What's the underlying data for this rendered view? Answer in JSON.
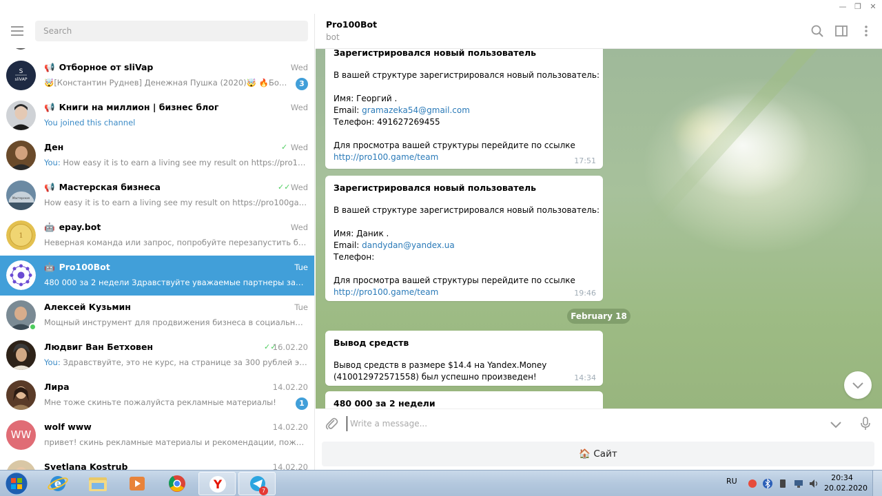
{
  "window": {
    "min_glyph": "—",
    "max_glyph": "❐",
    "close_glyph": "✕"
  },
  "sidebar": {
    "search_placeholder": "Search",
    "chats": [
      {
        "name": "Отборное от sliVap",
        "prefix": "📢",
        "time": "Wed",
        "preview": "🤯[Константин Руднев] Денежная Пушка (2020)🤯  🔥Бом...",
        "unread": "3",
        "avatar": "slivap"
      },
      {
        "name": "Книги на миллион | бизнес блог",
        "prefix": "📢",
        "time": "Wed",
        "preview": "You joined this channel",
        "avatar": "face-dark"
      },
      {
        "name": "Ден",
        "time": "Wed",
        "you": "You:",
        "preview": "How easy it is to earn a living see my result on https://pro100g...",
        "ticks": "✓",
        "avatar": "face-den"
      },
      {
        "name": "Мастерская бизнеса",
        "prefix": "📢",
        "time": "Wed",
        "preview": "How easy it is to earn a living see my result on https://pro100game...",
        "ticks": "✓✓",
        "avatar": "car"
      },
      {
        "name": "epay.bot",
        "prefix": "🤖",
        "time": "Wed",
        "preview": "Неверная команда или запрос, попробуйте перезапустить бота...",
        "avatar": "coin"
      },
      {
        "name": "Pro100Bot",
        "prefix": "🤖",
        "time": "Tue",
        "preview": "480 000 за 2 недели  Здравствуйте уважаемые партнеры записал...",
        "active": true,
        "avatar": "pro100"
      },
      {
        "name": "Алексей Кузьмин",
        "time": "Tue",
        "preview": "Мощный инструмент для продвижения бизнеса в социальных ...",
        "online": true,
        "avatar": "face-alexey"
      },
      {
        "name": "Людвиг Ван Бетховен",
        "time": "16.02.20",
        "you": "You:",
        "preview": "Здравствуйте, это не курс, на странице за 300 рублей это ре...",
        "ticks": "✓✓",
        "avatar": "beethoven"
      },
      {
        "name": "Лира",
        "time": "14.02.20",
        "preview": "Мне тоже скиньте пожалуйста рекламные материалы!",
        "unread": "1",
        "avatar": "lira"
      },
      {
        "name": "wolf www",
        "time": "14.02.20",
        "preview": "привет! скинь рекламные материалы и рекомендации, пожалу...",
        "avatar": "initials",
        "initials": "WW"
      },
      {
        "name": "Svetlana Kostrub",
        "time": "14.02.20",
        "preview": "",
        "avatar": "face-svetlana"
      }
    ]
  },
  "header": {
    "title": "Pro100Bot",
    "subtitle": "bot"
  },
  "messages": {
    "m1": {
      "title": "Зарегистрировался новый пользователь",
      "line1": "В вашей структуре зарегистрировался новый пользователь:",
      "name": "Имя: Георгий .",
      "email_label": "Email: ",
      "email": "gramazeka54@gmail.com",
      "phone": "Телефон: 491627269455",
      "cta": "Для просмотра вашей структуры перейдите по ссылке",
      "link": "http://pro100.game/team",
      "time": "17:51"
    },
    "m2": {
      "title": "Зарегистрировался новый пользователь",
      "line1": "В вашей структуре зарегистрировался новый пользователь:",
      "name": "Имя: Даник .",
      "email_label": "Email: ",
      "email": "dandydan@yandex.ua",
      "phone": "Телефон:",
      "cta": "Для просмотра вашей структуры перейдите по ссылке",
      "link": "http://pro100.game/team",
      "time": "19:46"
    },
    "date_divider": "February 18",
    "m3": {
      "title": "Вывод средств",
      "line1": "Вывод средств в размере $14.4 на Yandex.Money",
      "line2": "(410012972571558) был успешно произведен!",
      "time": "14:34"
    },
    "m4": {
      "title": "480 000 за 2 недели"
    }
  },
  "composer": {
    "placeholder": "Write a message..."
  },
  "bot_button": {
    "label": "🏠 Сайт"
  },
  "taskbar": {
    "lang": "RU",
    "time": "20:34",
    "date": "20.02.2020",
    "telegram_badge": "7"
  },
  "colors": {
    "accent": "#419fd9",
    "link": "#2a7ab8",
    "online": "#4dcd5e"
  }
}
